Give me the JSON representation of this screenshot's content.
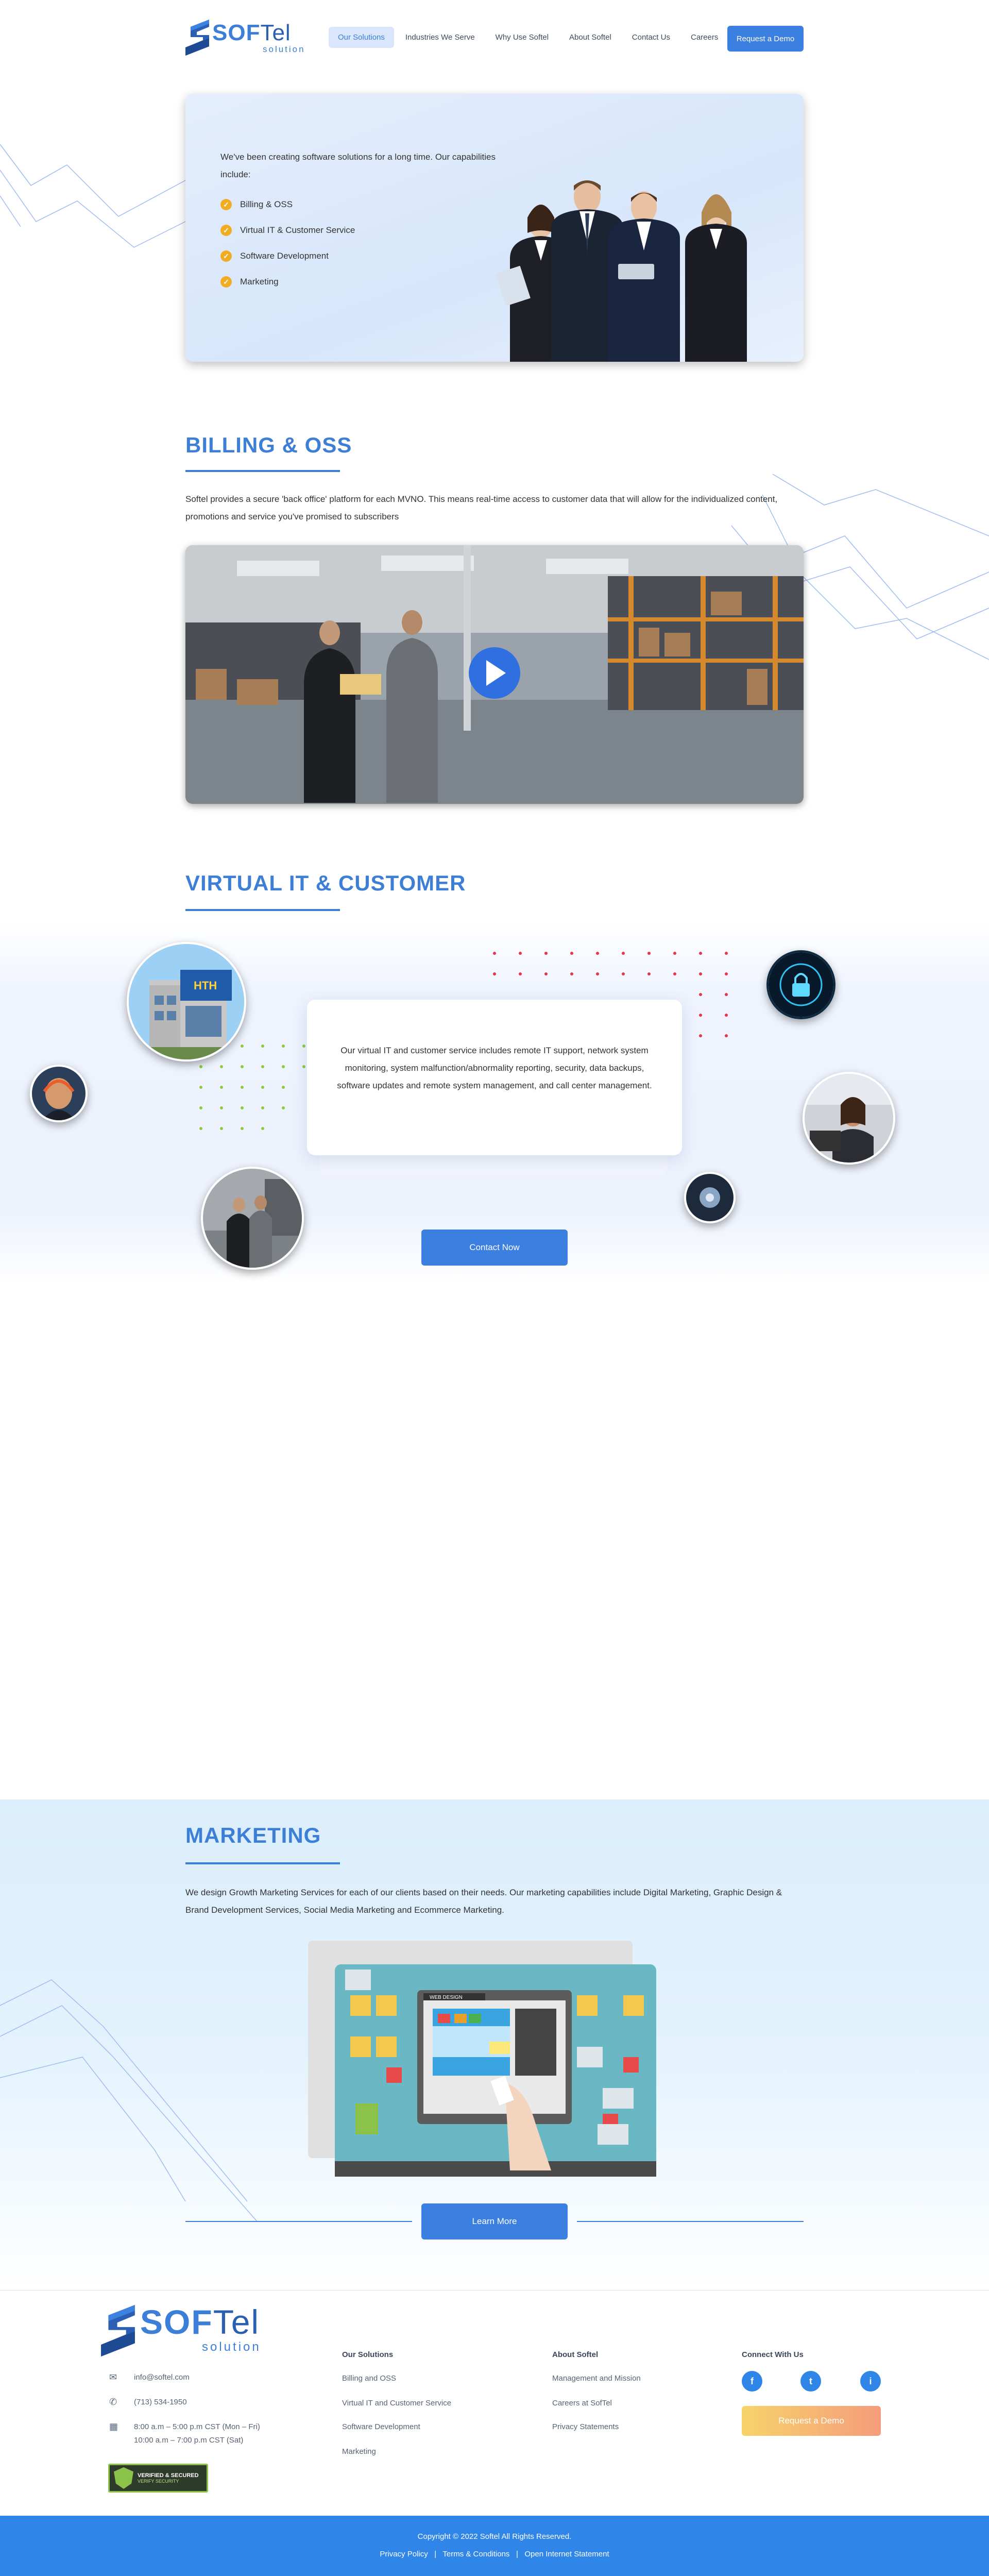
{
  "header": {
    "logo": {
      "brand": "SOFTel",
      "brand_main": "SOF",
      "brand_tail": "Tel",
      "tagline": "solution"
    },
    "nav": [
      {
        "label": "Our Solutions",
        "active": true
      },
      {
        "label": "Industries We Serve",
        "active": false
      },
      {
        "label": "Why Use Softel",
        "active": false
      },
      {
        "label": "About Softel",
        "active": false
      },
      {
        "label": "Contact Us",
        "active": false
      },
      {
        "label": "Careers",
        "active": false
      }
    ],
    "cta": "Request  a Demo"
  },
  "hero": {
    "intro": "We've been creating software solutions for a long time.  Our capabilities include:",
    "capabilities": [
      "Billing & OSS",
      "Virtual IT & Customer Service",
      "Software Development",
      "Marketing"
    ]
  },
  "billing": {
    "title": "BILLING & OSS",
    "text": "Softel provides a secure 'back office' platform for each MVNO. This means real-time access to customer data that will allow for the individualized content, promotions and service you've promised to subscribers"
  },
  "virtual": {
    "title": "VIRTUAL IT & CUSTOMER",
    "text": "Our virtual IT and customer service includes remote IT support, network system monitoring, system malfunction/abnormality reporting, security, data backups, software updates and remote system management, and call center management.",
    "cta": "Contact Now",
    "building_sign": "HTH"
  },
  "marketing": {
    "title": "MARKETING",
    "text": "We design Growth Marketing Services for each of our clients based on their needs.  Our marketing capabilities include Digital Marketing, Graphic Design & Brand Development Services, Social Media Marketing and Ecommerce Marketing.",
    "cta": "Learn More",
    "screen_label": "WEB DESIGN"
  },
  "footer": {
    "contact": {
      "email": "info@softel.com",
      "phone": "(713) 534-1950",
      "hours_weekday": "8:00 a.m – 5:00 p.m CST (Mon – Fri)",
      "hours_sat": "10:00 a.m – 7:00 p.m CST (Sat)",
      "badge_line1": "VERIFIED & SECURED",
      "badge_line2": "VERIFY SECURITY"
    },
    "solutions": {
      "title": "Our Solutions",
      "links": [
        "Billing and OSS",
        "Virtual IT and Customer Service",
        "Software Development",
        "Marketing"
      ]
    },
    "about": {
      "title": "About Softel",
      "links": [
        "Management and Mission",
        "Careers at SofTel",
        "Privacy Statements"
      ]
    },
    "connect": {
      "title": "Connect With Us",
      "social": [
        "f",
        "t",
        "i"
      ],
      "cta": "Request  a Demo"
    },
    "copyright": "Copyright © 2022 Softel All Rights Reserved.",
    "legal": [
      "Privacy Policy",
      "Terms & Conditions",
      "Open Internet Statement"
    ]
  },
  "colors": {
    "primary": "#3b7fe0",
    "heading": "#3d7fd6",
    "check": "#f0ad24",
    "footer_bar": "#2f86e8",
    "demo_gradient_start": "#f7d36a",
    "demo_gradient_end": "#f59c7c"
  }
}
